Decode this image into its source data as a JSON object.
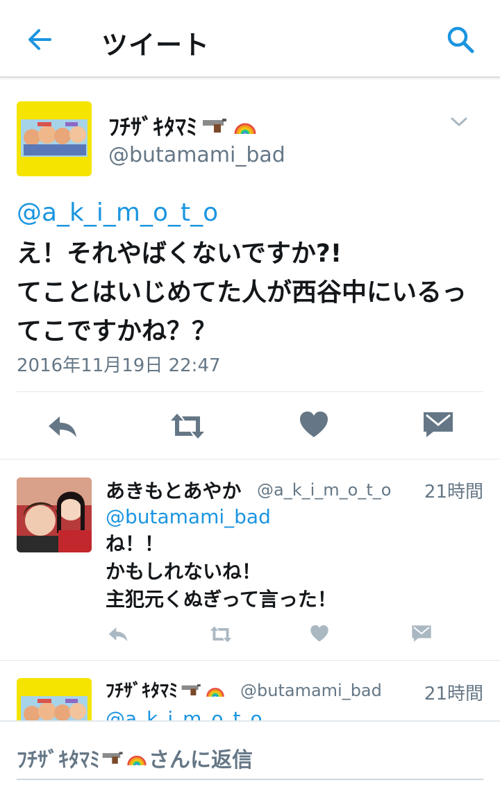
{
  "header": {
    "title": "ツイート"
  },
  "main_tweet": {
    "display_name": "ﾌﾁｻﾞｷﾀﾏﾐ",
    "handle": "@butamami_bad",
    "mention": "@a_k_i_m_o_t_o",
    "text": "え！それやばくないですか?!\nてことはいじめてた人が西谷中にいるってこですかね？？",
    "timestamp": "2016年11月19日 22:47"
  },
  "reply_tweet": {
    "display_name": "あきもとあやか",
    "handle": "@a_k_i_m_o_t_o",
    "time": "21時間",
    "mention": "@butamami_bad",
    "text": "ね！！\nかもしれないね！\n主犯元くぬぎって言った！"
  },
  "third_tweet": {
    "display_name": "ﾌﾁｻﾞｷﾀﾏﾐ",
    "handle": "@butamami_bad",
    "time": "21時間",
    "mention": "@a_k_i_m_o_t_o"
  },
  "composer": {
    "name": "ﾌﾁｻﾞｷﾀﾏﾐ",
    "suffix": "さんに返信"
  },
  "icons": {
    "back": "back-arrow-icon",
    "search": "search-icon",
    "chevron": "chevron-down-icon",
    "reply": "reply-icon",
    "retweet": "retweet-icon",
    "like": "heart-icon",
    "dm": "direct-message-icon",
    "pistol": "pistol-emoji",
    "rainbow": "rainbow-emoji"
  },
  "colors": {
    "accent": "#1b95e0",
    "secondary_text": "#657786",
    "action_icon": "#657786",
    "action_icon_light": "#aab8c2"
  }
}
